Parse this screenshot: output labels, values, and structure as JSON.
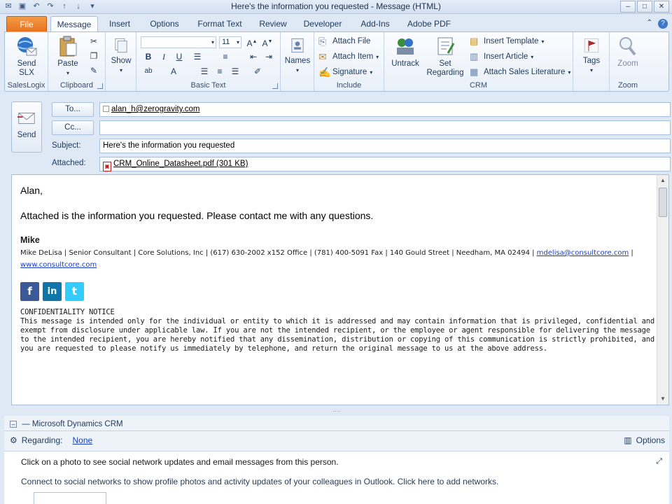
{
  "window": {
    "title": "Here's the information you requested  -  Message (HTML)"
  },
  "tabs": [
    {
      "label": "File"
    },
    {
      "label": "Message"
    },
    {
      "label": "Insert"
    },
    {
      "label": "Options"
    },
    {
      "label": "Format Text"
    },
    {
      "label": "Review"
    },
    {
      "label": "Developer"
    },
    {
      "label": "Add-Ins"
    },
    {
      "label": "Adobe PDF"
    }
  ],
  "ribbon": {
    "saleslogix": {
      "send_slx_label": "Send SLX",
      "send_slx_line1": "Send",
      "send_slx_line2": "SLX",
      "group_label": "SalesLogix"
    },
    "clipboard": {
      "paste_label": "Paste",
      "group_label": "Clipboard"
    },
    "show": {
      "label": "Show"
    },
    "basic_text": {
      "font_size": "11",
      "group_label": "Basic Text"
    },
    "names": {
      "label": "Names"
    },
    "include": {
      "attach_file": "Attach File",
      "attach_item": "Attach Item",
      "signature": "Signature",
      "group_label": "Include"
    },
    "crm": {
      "untrack": "Untrack",
      "set_regarding_line1": "Set",
      "set_regarding_line2": "Regarding",
      "insert_template": "Insert Template",
      "insert_article": "Insert Article",
      "attach_sales_lit": "Attach Sales Literature",
      "group_label": "CRM"
    },
    "tags": {
      "label": "Tags"
    },
    "zoom": {
      "label": "Zoom",
      "group_label": "Zoom"
    }
  },
  "header": {
    "send_label": "Send",
    "to_label": "To...",
    "to_value": "alan_h@zerogravity.com",
    "cc_label": "Cc...",
    "cc_value": "",
    "subject_label": "Subject:",
    "subject_value": "Here's the information you requested",
    "attached_label": "Attached:",
    "attached_value": "CRM_Online_Datasheet.pdf (301 KB)"
  },
  "body": {
    "greeting": "Alan,",
    "message": "Attached is the information you requested. Please contact me with any questions.",
    "sig_name": "Mike",
    "sig_line": "Mike DeLisa | Senior Consultant | Core Solutions, Inc | (617) 630-2002 x152 Office | (781) 400-5091 Fax | 140 Gould Street | Needham, MA 02494 | ",
    "sig_email": "mdelisa@consultcore.com",
    "sig_sep": " |",
    "sig_web": "www.consultcore.com",
    "conf_title": "CONFIDENTIALITY NOTICE",
    "conf_text": "This message is intended only for the individual or entity to which it is addressed and may contain information that is privileged, confidential and exempt from disclosure under applicable law. If you are not the intended recipient, or the employee or agent responsible for delivering the message to the intended recipient, you are hereby notified that any dissemination, distribution or copying of this communication is strictly prohibited, and you are requested to please notify us immediately by telephone, and return the original message to us at the above address."
  },
  "crm_panel": {
    "title": "Microsoft Dynamics CRM",
    "regarding_label": "Regarding:",
    "regarding_value": "None",
    "options_label": "Options"
  },
  "social_panel": {
    "line1": "Click on a photo to see social network updates and email messages from this person.",
    "line2": "Connect to social networks to show profile photos and activity updates of your colleagues in Outlook. Click here to add networks."
  },
  "colors": {
    "file_tab": "#e7711f",
    "link": "#1a3ec0",
    "ribbon_bg": "#fbfcfe",
    "facebook": "#3b5998",
    "linkedin": "#0e76a8",
    "twitter": "#33ccff"
  }
}
